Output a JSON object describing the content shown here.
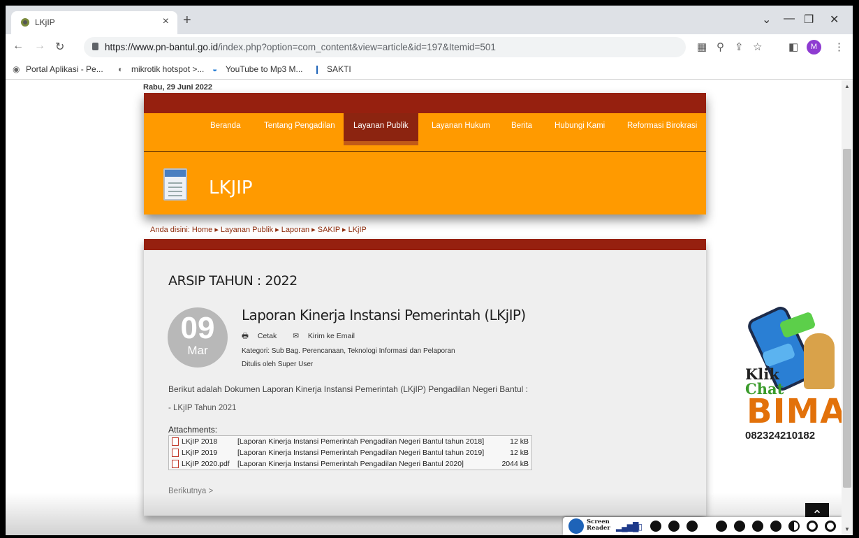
{
  "browser": {
    "tab_title": "LKjIP",
    "tab_close": "×",
    "new_tab": "+",
    "url_host": "https://www.pn-bantul.go.id",
    "url_path": "/index.php?option=com_content&view=article&id=197&Itemid=501",
    "avatar_letter": "M",
    "bookmarks": [
      "Portal Aplikasi - Pe...",
      "mikrotik hotspot >...",
      "YouTube to Mp3 M...",
      "SAKTI"
    ]
  },
  "site": {
    "date": "Rabu, 29 Juni 2022",
    "menu": [
      "Beranda",
      "Tentang Pengadilan",
      "Layanan Publik",
      "Layanan Hukum",
      "Berita",
      "Hubungi Kami",
      "Reformasi Birokrasi"
    ],
    "active_menu": "Layanan Publik",
    "page_title": "LKJIP",
    "breadcrumb": "Anda disini: Home ▸ Layanan Publik ▸ Laporan ▸ SAKIP ▸ LKjIP"
  },
  "article": {
    "archive_heading": "ARSIP TAHUN : 2022",
    "day": "09",
    "month": "Mar",
    "title": "Laporan Kinerja Instansi Pemerintah (LKjIP)",
    "print_label": "Cetak",
    "email_label": "Kirim ke Email",
    "category": "Kategori: Sub Bag. Perencanaan, Teknologi Informasi dan Pelaporan",
    "author": "Ditulis oleh Super User",
    "body": "Berikut adalah Dokumen Laporan Kinerja Instansi Pemerintah (LKjIP) Pengadilan Negeri Bantul :",
    "body_item": "- LKjIP Tahun 2021",
    "attachments_label": "Attachments:",
    "attachments": [
      {
        "name": "LKjIP 2018",
        "desc": "[Laporan Kinerja Instansi Pemerintah Pengadilan Negeri Bantul tahun 2018]",
        "size": "12 kB"
      },
      {
        "name": "LKjIP 2019",
        "desc": "[Laporan Kinerja Instansi Pemerintah Pengadilan Negeri Bantul tahun 2019]",
        "size": "12 kB"
      },
      {
        "name": "LKjIP 2020.pdf",
        "desc": "[Laporan Kinerja Instansi Pemerintah Pengadilan Negeri Bantul 2020]",
        "size": "2044 kB"
      }
    ],
    "next_link": "Berikutnya >"
  },
  "widget": {
    "klik": "Klik",
    "chat": "Chat",
    "bima": "BIMA",
    "phone": "082324210182"
  },
  "screen_reader": {
    "label_1": "Screen",
    "label_2": "Reader"
  }
}
